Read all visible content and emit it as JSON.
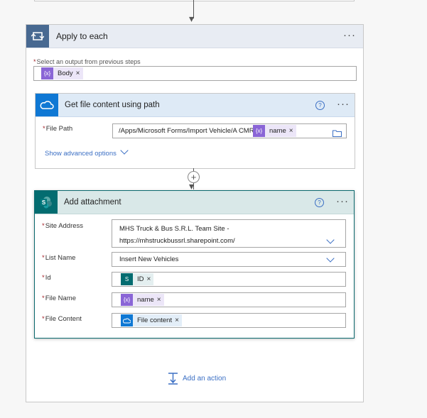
{
  "loop": {
    "title": "Apply to each",
    "select_label": "Select an output from previous steps",
    "select_token": "Body",
    "required_mark": "*"
  },
  "get_file": {
    "title": "Get file content using path",
    "file_path_label": "File Path",
    "file_path_text": "/Apps/Microsoft Forms/Import Vehicle/A CMR/",
    "file_path_token": "name",
    "show_advanced": "Show advanced options"
  },
  "add_attachment": {
    "title": "Add attachment",
    "site_address_label": "Site Address",
    "site_address_line1": "MHS Truck &  Bus S.R.L. Team Site -",
    "site_address_line2": "https://mhstruckbussrl.sharepoint.com/",
    "list_name_label": "List Name",
    "list_name_value": "Insert New Vehicles",
    "id_label": "Id",
    "id_token": "ID",
    "file_name_label": "File Name",
    "file_name_token": "name",
    "file_content_label": "File Content",
    "file_content_token": "File content"
  },
  "common": {
    "more": "···",
    "help": "?",
    "remove": "×",
    "plus": "+",
    "token_icon": "{x}"
  },
  "footer": {
    "add_action": "Add an action"
  },
  "colors": {
    "loop_accent": "#486991",
    "onedrive_accent": "#0f78d4",
    "sharepoint_accent": "#036c70",
    "expression_token": "#8a65d6",
    "link": "#3b6fc4",
    "required": "#a4262c"
  }
}
